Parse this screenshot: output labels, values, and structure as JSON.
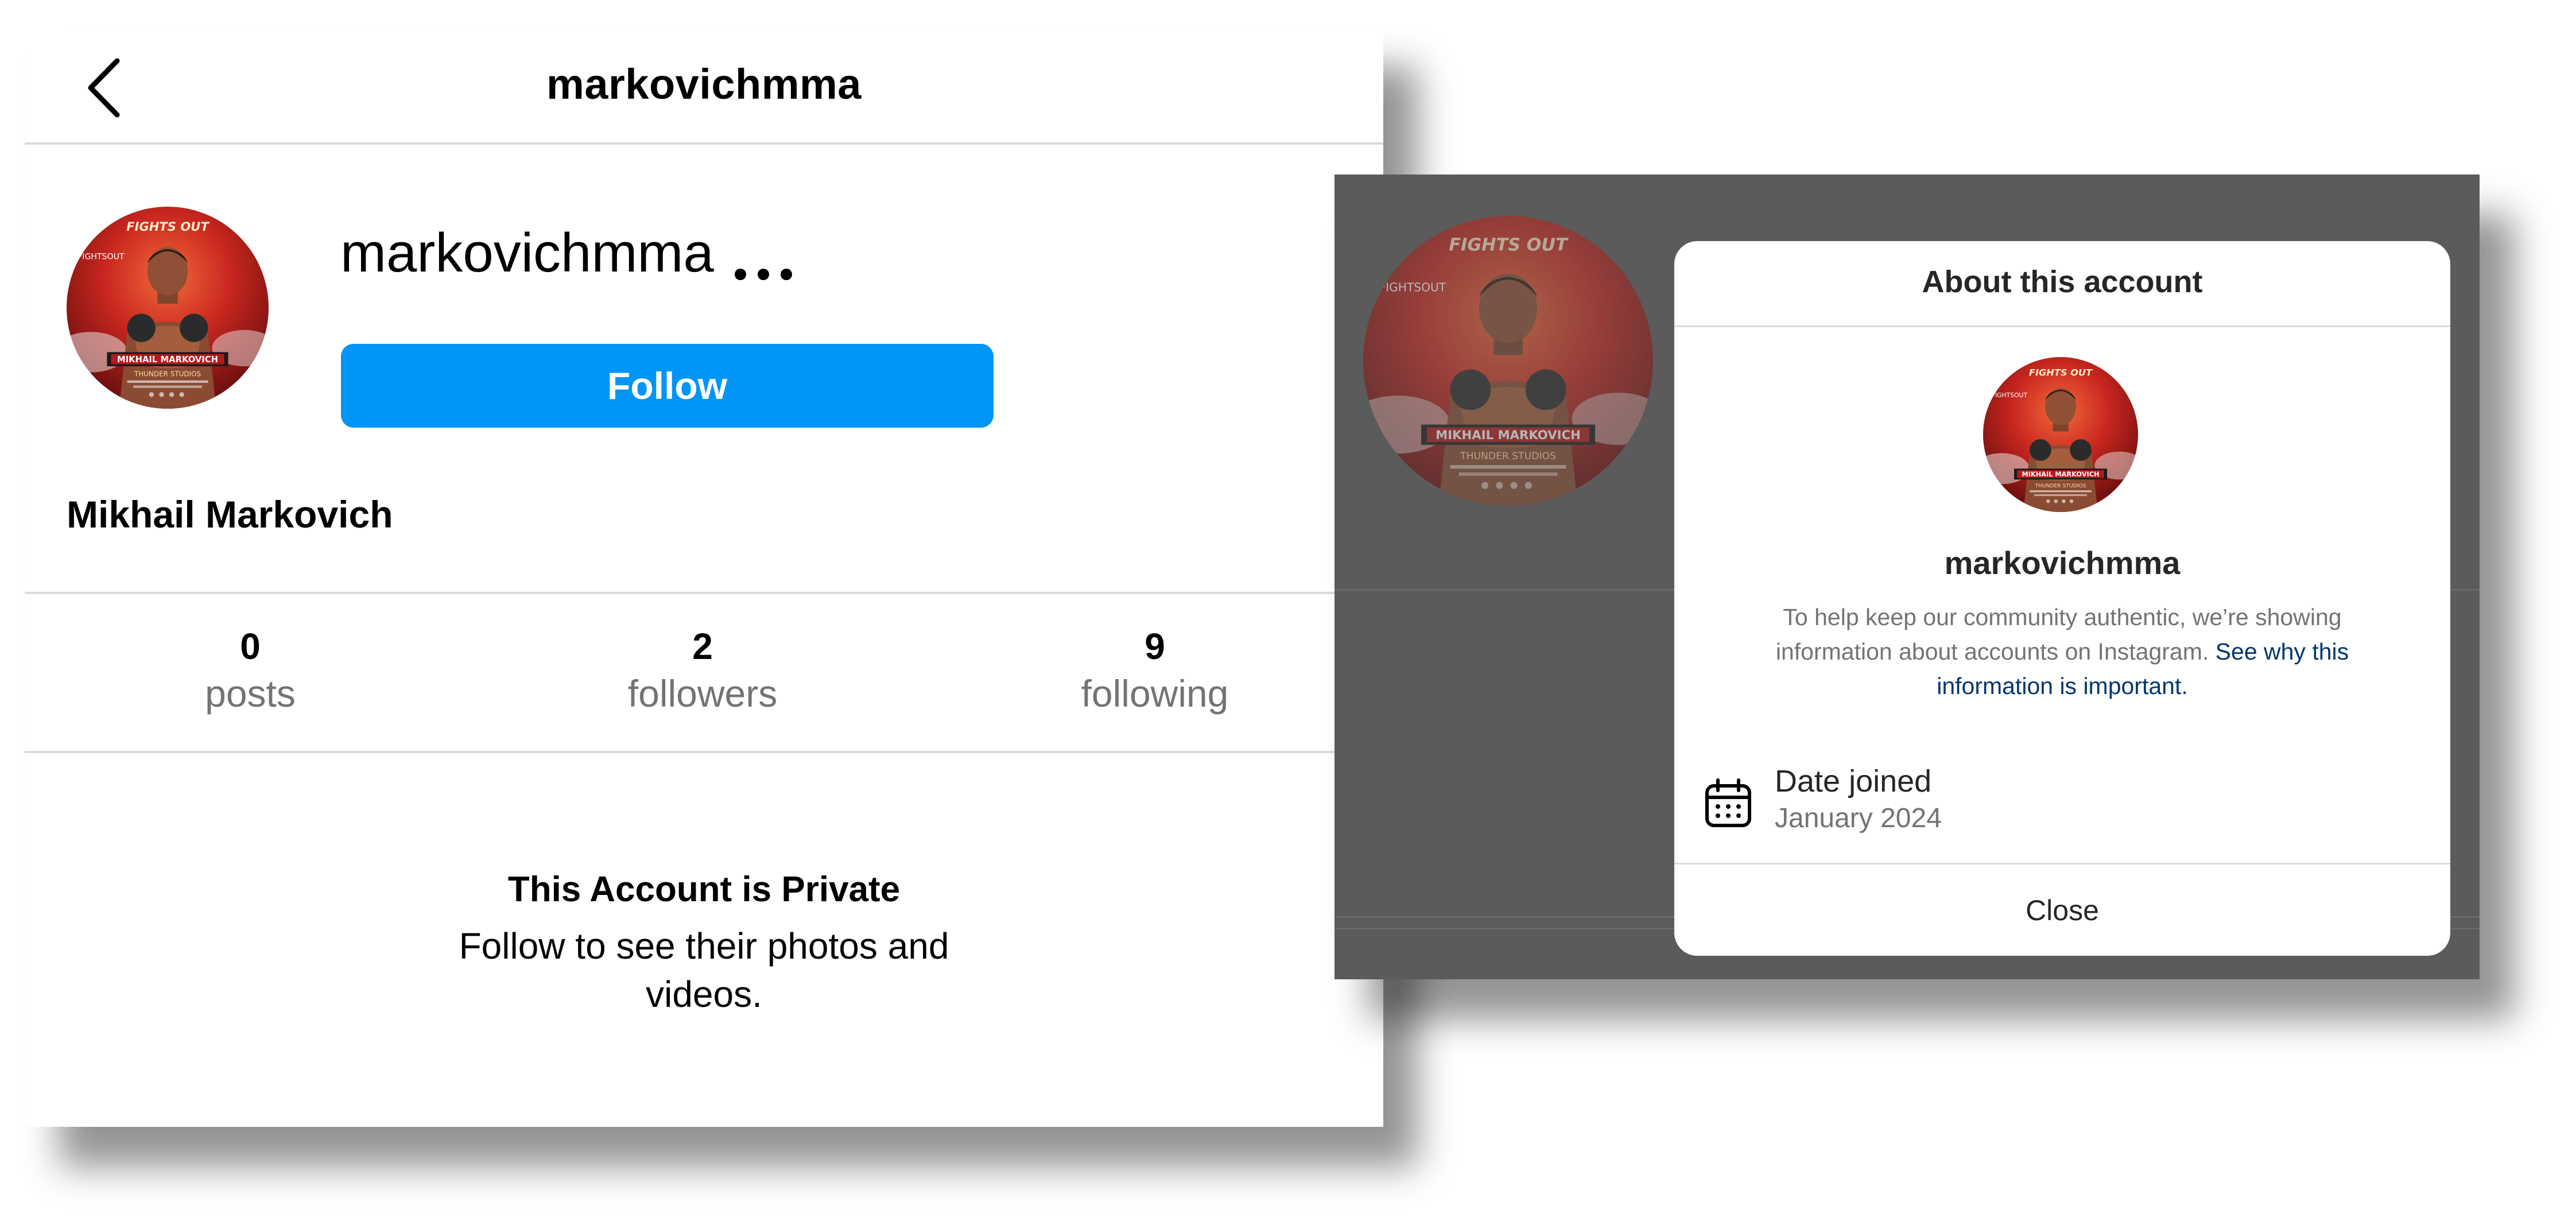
{
  "profile": {
    "header_title": "markovichmma",
    "username": "markovichmma",
    "follow_label": "Follow",
    "full_name": "Mikhail Markovich",
    "stats": [
      {
        "count": "0",
        "label": "posts"
      },
      {
        "count": "2",
        "label": "followers"
      },
      {
        "count": "9",
        "label": "following"
      }
    ],
    "private_title": "This Account is Private",
    "private_subtitle": "Follow to see their photos and videos.",
    "icons": {
      "back": "chevron-left-icon",
      "more": "more-horizontal-icon"
    }
  },
  "about_dialog": {
    "title": "About this account",
    "username": "markovichmma",
    "info_text": "To help keep our community authentic, we’re showing information about accounts on Instagram.",
    "info_link": "See why this information is important.",
    "date_joined_label": "Date joined",
    "date_joined_value": "January 2024",
    "close_label": "Close",
    "icons": {
      "calendar": "calendar-icon"
    }
  },
  "colors": {
    "follow_button": "#0095f6",
    "link": "#00376b",
    "secondary_text": "#737373",
    "divider": "#dbdbdb",
    "overlay": "#5b5b5b"
  }
}
